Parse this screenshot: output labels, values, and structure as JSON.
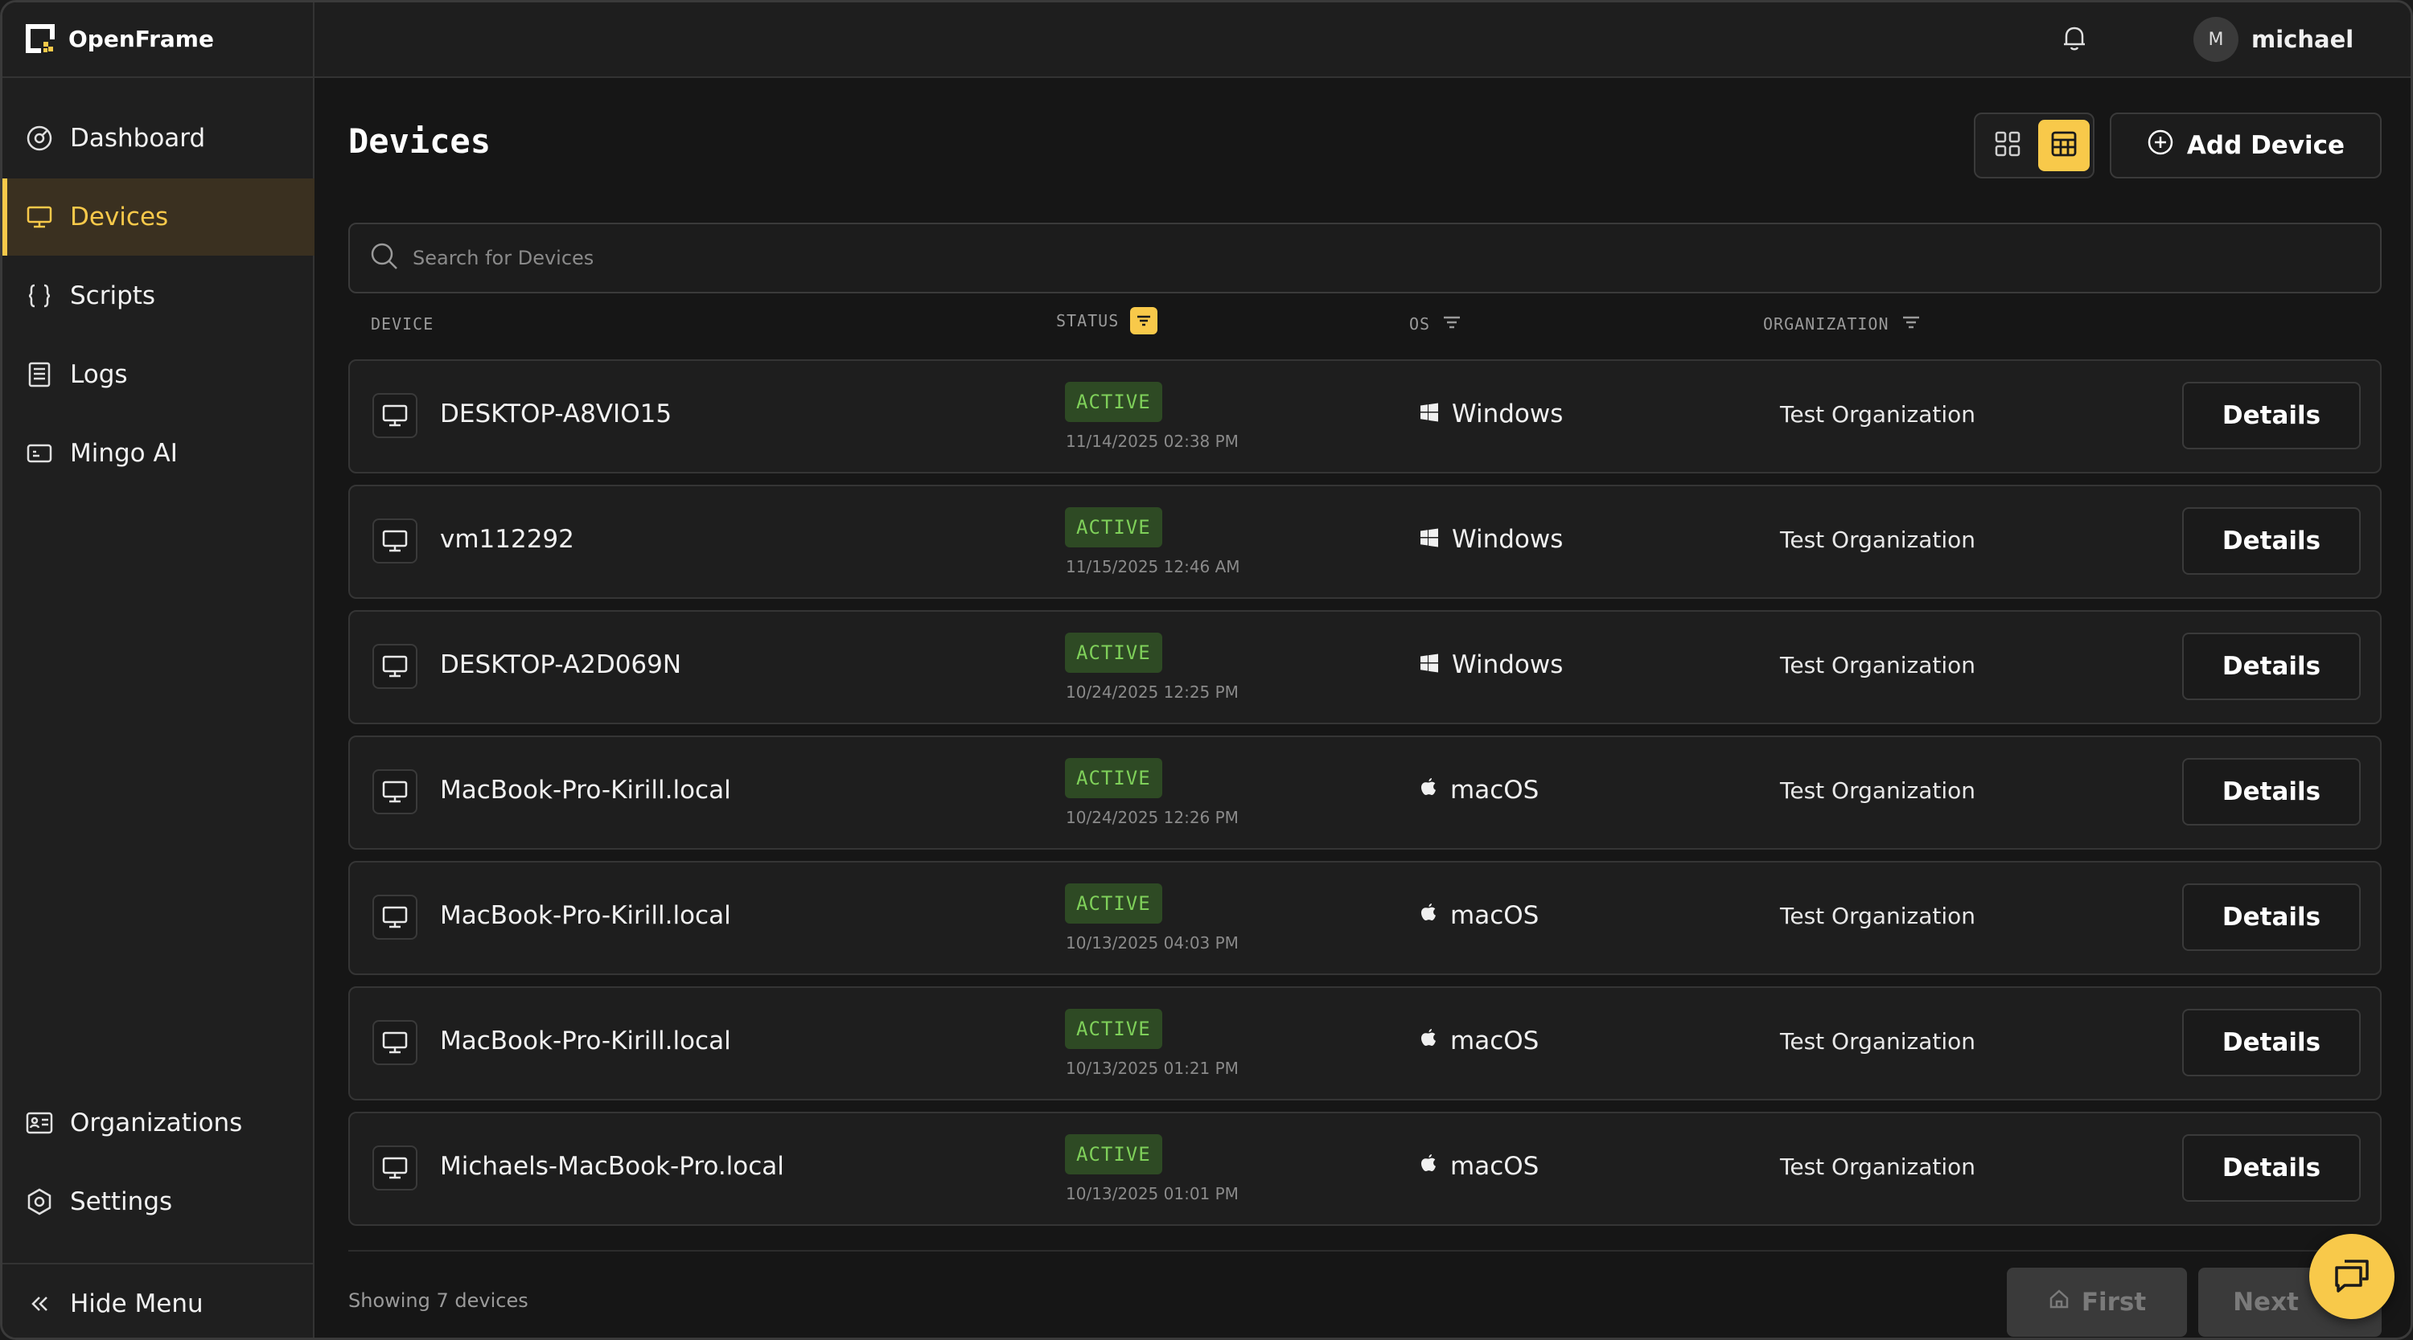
{
  "app": {
    "name": "OpenFrame"
  },
  "sidebar": {
    "items": [
      {
        "label": "Dashboard",
        "icon": "dashboard-icon",
        "active": false
      },
      {
        "label": "Devices",
        "icon": "monitor-icon",
        "active": true
      },
      {
        "label": "Scripts",
        "icon": "braces-icon",
        "active": false
      },
      {
        "label": "Logs",
        "icon": "logs-icon",
        "active": false
      },
      {
        "label": "Mingo AI",
        "icon": "ai-chip-icon",
        "active": false
      }
    ],
    "bottom_items": [
      {
        "label": "Organizations",
        "icon": "organization-card-icon"
      },
      {
        "label": "Settings",
        "icon": "gear-icon"
      }
    ],
    "hide_menu_label": "Hide Menu"
  },
  "header": {
    "user_initial": "M",
    "username": "michael"
  },
  "page": {
    "title": "Devices",
    "add_device_label": "Add Device",
    "search_placeholder": "Search for Devices"
  },
  "table": {
    "columns": {
      "device": "DEVICE",
      "status": "STATUS",
      "os": "OS",
      "organization": "ORGANIZATION"
    },
    "details_label": "Details",
    "rows": [
      {
        "device": "DESKTOP-A8VIO15",
        "status": "ACTIVE",
        "time": "11/14/2025 02:38 PM",
        "os": "Windows",
        "organization": "Test Organization"
      },
      {
        "device": "vm112292",
        "status": "ACTIVE",
        "time": "11/15/2025 12:46 AM",
        "os": "Windows",
        "organization": "Test Organization"
      },
      {
        "device": "DESKTOP-A2D069N",
        "status": "ACTIVE",
        "time": "10/24/2025 12:25 PM",
        "os": "Windows",
        "organization": "Test Organization"
      },
      {
        "device": "MacBook-Pro-Kirill.local",
        "status": "ACTIVE",
        "time": "10/24/2025 12:26 PM",
        "os": "macOS",
        "organization": "Test Organization"
      },
      {
        "device": "MacBook-Pro-Kirill.local",
        "status": "ACTIVE",
        "time": "10/13/2025 04:03 PM",
        "os": "macOS",
        "organization": "Test Organization"
      },
      {
        "device": "MacBook-Pro-Kirill.local",
        "status": "ACTIVE",
        "time": "10/13/2025 01:21 PM",
        "os": "macOS",
        "organization": "Test Organization"
      },
      {
        "device": "Michaels-MacBook-Pro.local",
        "status": "ACTIVE",
        "time": "10/13/2025 01:01 PM",
        "os": "macOS",
        "organization": "Test Organization"
      }
    ]
  },
  "footer": {
    "showing_text": "Showing 7 devices",
    "first_label": "First",
    "next_label": "Next"
  },
  "colors": {
    "accent": "#f8c94a",
    "active_badge_bg": "#2e4a24",
    "active_badge_text": "#7fd05a",
    "background": "#161616"
  }
}
